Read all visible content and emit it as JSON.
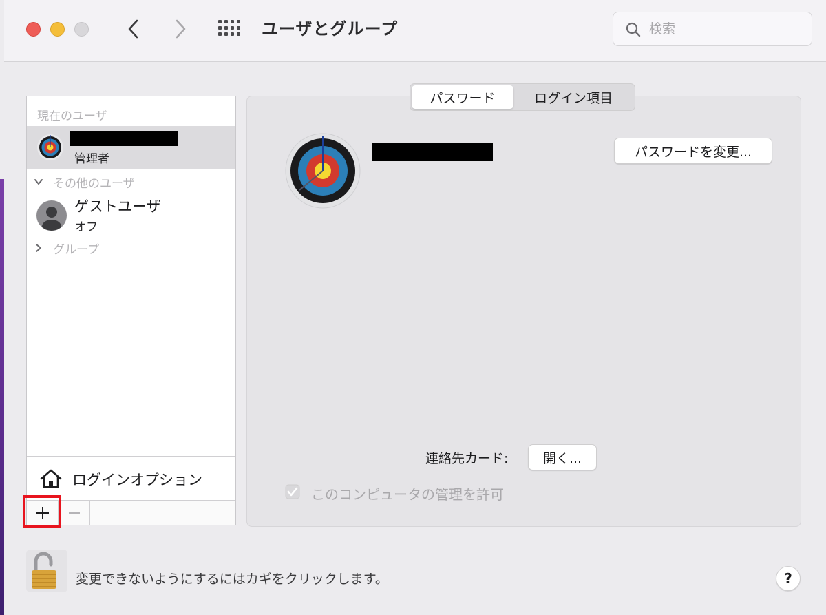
{
  "window": {
    "title": "ユーザとグループ"
  },
  "search": {
    "placeholder": "検索",
    "value": ""
  },
  "sidebar": {
    "current_users_header": "現在のユーザ",
    "current_user": {
      "role": "管理者"
    },
    "other_users_header": "その他のユーザ",
    "guest": {
      "name": "ゲストユーザ",
      "status": "オフ"
    },
    "groups_header": "グループ",
    "login_options_label": "ログインオプション",
    "add_label": "+",
    "remove_label": "−"
  },
  "tabs": [
    {
      "label": "パスワード",
      "selected": true
    },
    {
      "label": "ログイン項目",
      "selected": false
    }
  ],
  "panel": {
    "change_password_label": "パスワードを変更...",
    "contact_card_label": "連絡先カード:",
    "open_label": "開く...",
    "admin_checkbox_label": "このコンピュータの管理を許可",
    "admin_checked": true
  },
  "footer": {
    "lock_text": "変更できないようにするにはカギをクリックします。",
    "help_label": "?"
  },
  "colors": {
    "close": "#ee5d57",
    "minimize": "#f4be39",
    "zoom_disabled": "#d8d7da",
    "highlight": "#e8141e"
  }
}
